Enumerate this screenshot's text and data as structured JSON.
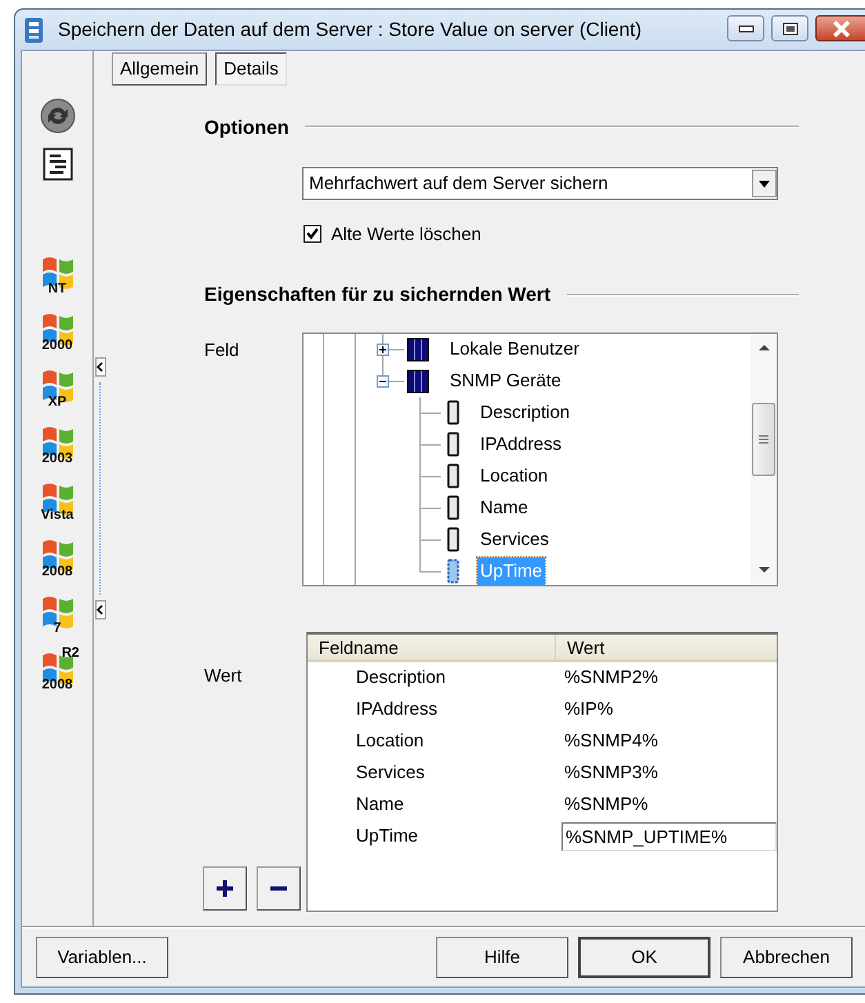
{
  "window": {
    "title": "Speichern der Daten auf dem Server : Store Value on server (Client)"
  },
  "sidebar": {
    "os_icons": [
      {
        "label": "NT"
      },
      {
        "label": "2000"
      },
      {
        "label": "XP"
      },
      {
        "label": "2003"
      },
      {
        "label": "Vista"
      },
      {
        "label": "2008"
      },
      {
        "label": "7"
      },
      {
        "label": "2008",
        "badge": "R2"
      }
    ]
  },
  "tabs": [
    {
      "label": "Allgemein",
      "selected": false
    },
    {
      "label": "Details",
      "selected": true
    }
  ],
  "options": {
    "heading": "Optionen",
    "mode_select": {
      "value": "Mehrfachwert auf dem Server sichern"
    },
    "delete_old": {
      "label": "Alte Werte löschen",
      "checked": true
    }
  },
  "properties": {
    "heading": "Eigenschaften für zu sichernden Wert",
    "field_label": "Feld",
    "tree": [
      {
        "label": "Lokale Benutzer",
        "expanded": false,
        "selected": false
      },
      {
        "label": "SNMP Geräte",
        "expanded": true,
        "selected": false,
        "children": [
          {
            "label": "Description",
            "selected": false
          },
          {
            "label": "IPAddress",
            "selected": false
          },
          {
            "label": "Location",
            "selected": false
          },
          {
            "label": "Name",
            "selected": false
          },
          {
            "label": "Services",
            "selected": false
          },
          {
            "label": "UpTime",
            "selected": true
          }
        ]
      }
    ],
    "value_label": "Wert",
    "table": {
      "columns": [
        "Feldname",
        "Wert"
      ],
      "rows": [
        {
          "name": "Description",
          "value": "%SNMP2%",
          "editing": false
        },
        {
          "name": "IPAddress",
          "value": "%IP%",
          "editing": false
        },
        {
          "name": "Location",
          "value": "%SNMP4%",
          "editing": false
        },
        {
          "name": "Services",
          "value": "%SNMP3%",
          "editing": false
        },
        {
          "name": "Name",
          "value": "%SNMP%",
          "editing": false
        },
        {
          "name": "UpTime",
          "value": "%SNMP_UPTIME%",
          "editing": true
        }
      ]
    }
  },
  "buttons": {
    "variables": "Variablen...",
    "actions": [
      {
        "label": "Hilfe",
        "default": false
      },
      {
        "label": "OK",
        "default": true
      },
      {
        "label": "Abbrechen",
        "default": false
      }
    ]
  }
}
